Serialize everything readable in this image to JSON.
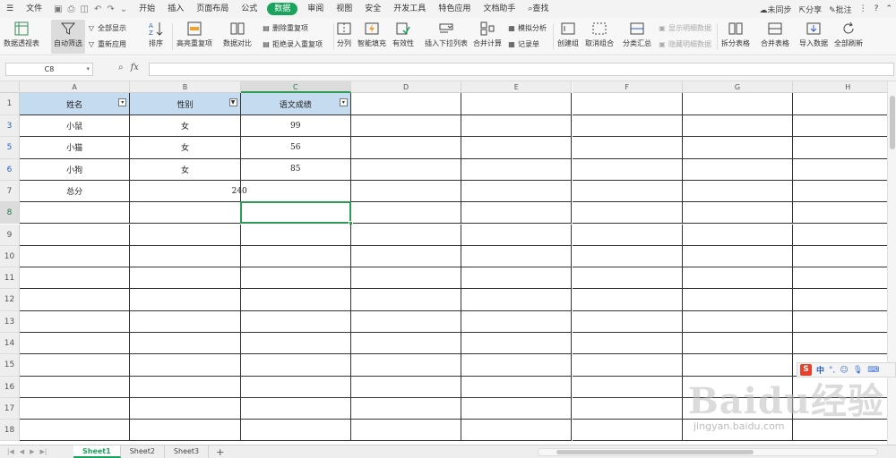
{
  "menubar": {
    "items": [
      "文件",
      "开始",
      "插入",
      "页面布局",
      "公式",
      "数据",
      "审阅",
      "视图",
      "安全",
      "开发工具",
      "特色应用",
      "文档助手",
      "查找"
    ],
    "active_index": 5,
    "right": {
      "sync": "未同步",
      "share": "分享",
      "comment": "批注"
    }
  },
  "ribbon": {
    "pivot": "数据透视表",
    "autofilter": "自动筛选",
    "show_all": "全部显示",
    "reapply": "重新应用",
    "sort": "排序",
    "highlight_dup": "高亮重复项",
    "compare": "数据对比",
    "remove_dup": "删除重复项",
    "reject_dup": "拒绝录入重复项",
    "split": "分列",
    "flash_fill": "智能填充",
    "validity": "有效性",
    "dropdown_list": "插入下拉列表",
    "consolidate": "合并计算",
    "simulate": "模拟分析",
    "record": "记录单",
    "group": "创建组",
    "ungroup": "取消组合",
    "subtotal": "分类汇总",
    "show_detail": "显示明细数据",
    "hide_detail": "隐藏明细数据",
    "split_table": "拆分表格",
    "merge_table": "合并表格",
    "import": "导入数据",
    "refresh_all": "全部刷新"
  },
  "formula_bar": {
    "name_box": "C8",
    "fx": "fx",
    "value": ""
  },
  "columns": [
    "A",
    "B",
    "C",
    "D",
    "E",
    "F",
    "G",
    "H"
  ],
  "rows": [
    {
      "num": "1",
      "cells": [
        "姓名",
        "性别",
        "语文成绩"
      ]
    },
    {
      "num": "3",
      "cells": [
        "小鼠",
        "女",
        "99"
      ]
    },
    {
      "num": "5",
      "cells": [
        "小猫",
        "女",
        "56"
      ]
    },
    {
      "num": "6",
      "cells": [
        "小狗",
        "女",
        "85"
      ]
    },
    {
      "num": "7",
      "cells": [
        "总分",
        "",
        "240"
      ]
    },
    {
      "num": "8",
      "cells": [
        "",
        "",
        ""
      ]
    },
    {
      "num": "9",
      "cells": [
        "",
        "",
        ""
      ]
    },
    {
      "num": "10",
      "cells": [
        "",
        "",
        ""
      ]
    },
    {
      "num": "11",
      "cells": [
        "",
        "",
        ""
      ]
    },
    {
      "num": "12",
      "cells": [
        "",
        "",
        ""
      ]
    },
    {
      "num": "13",
      "cells": [
        "",
        "",
        ""
      ]
    },
    {
      "num": "14",
      "cells": [
        "",
        "",
        ""
      ]
    },
    {
      "num": "15",
      "cells": [
        "",
        "",
        ""
      ]
    },
    {
      "num": "16",
      "cells": [
        "",
        "",
        ""
      ]
    },
    {
      "num": "17",
      "cells": [
        "",
        "",
        ""
      ]
    },
    {
      "num": "18",
      "cells": [
        "",
        "",
        ""
      ]
    }
  ],
  "selected_cell": "C8",
  "sheets": [
    "Sheet1",
    "Sheet2",
    "Sheet3"
  ],
  "active_sheet": 0,
  "ime": {
    "logo": "S",
    "mode": "中"
  },
  "watermark": {
    "brand": "Baidu经验",
    "url": "jingyan.baidu.com"
  },
  "colors": {
    "accent": "#1aa35c",
    "header_fill": "#c5dbef",
    "selection": "#2e9a52"
  }
}
